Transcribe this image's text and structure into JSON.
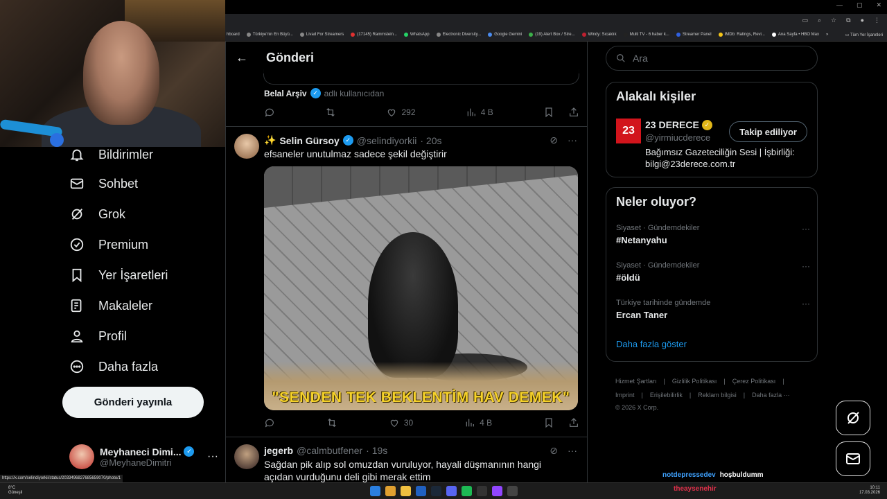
{
  "window": {
    "controls": [
      "—",
      "▢",
      "✕"
    ]
  },
  "bookmarks": {
    "items": [
      "hboard",
      "Türkiye'nin En Büyü...",
      "Livad For Streamers",
      "(17145) Rammstein...",
      "WhatsApp",
      "Electronic Diversity...",
      "Google Gemini",
      "(19) Alert Box / Stre...",
      "Windy: Sıcaklık",
      "Multi TV - 6 haber k...",
      "Streamer Panel",
      "IMDb: Ratings, Revi...",
      "Ana Sayfa • HBO Max"
    ],
    "more": "»",
    "all": "Tüm Yer İşaretleri"
  },
  "sidebar": {
    "nav": [
      {
        "label": "Bildirimler",
        "icon": "bell-icon"
      },
      {
        "label": "Sohbet",
        "icon": "mail-icon"
      },
      {
        "label": "Grok",
        "icon": "grok-icon"
      },
      {
        "label": "Premium",
        "icon": "premium-icon"
      },
      {
        "label": "Yer İşaretleri",
        "icon": "bookmark-icon"
      },
      {
        "label": "Makaleler",
        "icon": "article-icon"
      },
      {
        "label": "Profil",
        "icon": "profile-icon"
      },
      {
        "label": "Daha fazla",
        "icon": "more-circle-icon"
      }
    ],
    "post_button": "Gönderi yayınla",
    "account": {
      "name": "Meyhaneci Dimi...",
      "handle": "@MeyhaneDimitri",
      "more": "···"
    }
  },
  "main": {
    "title": "Gönderi",
    "repost_by": "Belal Arşiv",
    "repost_suffix": "adlı kullanıcıdan",
    "prev_actions": {
      "likes": "292",
      "views": "4 B"
    },
    "tweet": {
      "name": "Selin Gürsoy",
      "handle": "@selindiyorkii",
      "time": "· 20s",
      "text": "efsaneler unutulmaz sadece şekil değiştirir",
      "media_caption": "\"SENDEN TEK BEKLENTİM HAV DEMEK\"",
      "likes": "30",
      "views": "4 B"
    },
    "tweet2": {
      "name": "jegerb",
      "handle": "@calmbutfener",
      "time": "· 19s",
      "text": "Sağdan pik alıp sol omuzdan vuruluyor, hayali düşmanının hangi açıdan vurduğunu deli gibi merak ettim"
    }
  },
  "right": {
    "search_placeholder": "Ara",
    "related": {
      "title": "Alakalı kişiler",
      "avatar_text": "23",
      "name": "23 DERECE",
      "handle": "@yirmiucderece",
      "follow": "Takip ediliyor",
      "bio": "Bağımsız Gazeteciliğin Sesi | İşbirliği: bilgi@23derece.com.tr"
    },
    "trends": {
      "title": "Neler oluyor?",
      "items": [
        {
          "context": "Siyaset · Gündemdekiler",
          "topic": "#Netanyahu"
        },
        {
          "context": "Siyaset · Gündemdekiler",
          "topic": "#öldü"
        },
        {
          "context": "Türkiye tarihinde gündemde",
          "topic": "Ercan Taner"
        }
      ],
      "more": "Daha fazla göster",
      "dots": "···"
    },
    "footer": {
      "line1": [
        "Hizmet Şartları",
        "|",
        "Gizlilik Politikası",
        "|",
        "Çerez Politikası",
        "|"
      ],
      "line2": [
        "Imprint",
        "|",
        "Erişilebilirlik",
        "|",
        "Reklam bilgisi",
        "|",
        "Daha fazla ···"
      ],
      "copyright": "© 2026 X Corp."
    }
  },
  "overlay": {
    "chat_user": "notdepressedev",
    "chat_msg": "hoşbuldumm",
    "chat_user2": "theaysenehir",
    "status_url": "https://x.com/selindiyorkii/status/2033496827685659070/photo/1"
  },
  "taskbar": {
    "weather_temp": "8°C",
    "weather_desc": "Güneşli",
    "time": "10:11",
    "date": "17.03.2026"
  },
  "colors": {
    "accent": "#1d9bf0",
    "gold": "#e2b719",
    "caption": "#f6d22a",
    "brand_red": "#d2141c"
  }
}
